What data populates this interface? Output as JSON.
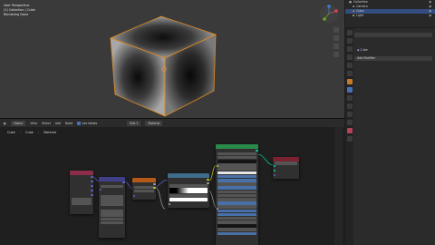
{
  "viewport": {
    "info_lines": [
      "User Perspective",
      "(1) Collection | Cube",
      "Rendering Done"
    ]
  },
  "node_header": {
    "items": [
      "Object",
      "View",
      "Select",
      "Add",
      "Node",
      "Use Nodes",
      "Slot 1",
      "Material"
    ]
  },
  "breadcrumb": {
    "object": "Cube",
    "mesh": "Cube",
    "material": "Material"
  },
  "outliner": {
    "rows": [
      {
        "label": "Collection",
        "selected": false
      },
      {
        "label": "Camera",
        "selected": false
      },
      {
        "label": "Cube",
        "selected": true
      },
      {
        "label": "Light",
        "selected": false
      }
    ]
  },
  "properties": {
    "object_name": "Cube",
    "panel_label": "Add Modifier"
  },
  "colors": {
    "selection_orange": "#e08a1e",
    "shader_node_green": "#2a8a4a",
    "output_node_red": "#7a2230",
    "texture_node_orange": "#b35a1a",
    "vector_node_purple": "#3f3f8a",
    "input_node_pink": "#8a2e4a"
  }
}
